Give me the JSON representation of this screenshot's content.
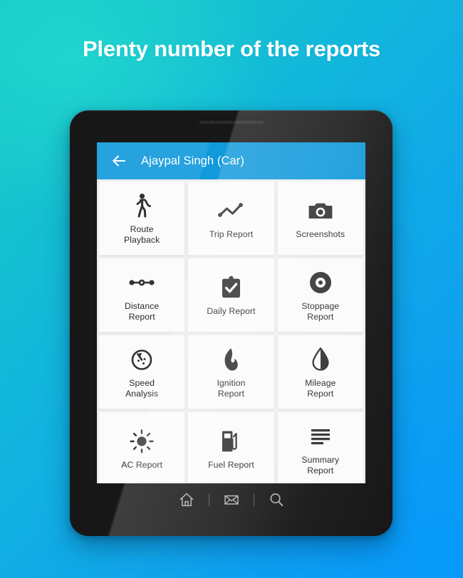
{
  "headline": "Plenty number of the reports",
  "app": {
    "appbar": {
      "back_icon": "arrow-left-icon",
      "title": "Ajaypal Singh (Car)",
      "background_color": "#1099db"
    },
    "reports": [
      {
        "label": "Route\nPlayback",
        "icon": "walking-person-icon"
      },
      {
        "label": "Trip Report",
        "icon": "line-chart-icon"
      },
      {
        "label": "Screenshots",
        "icon": "camera-icon"
      },
      {
        "label": "Distance\nReport",
        "icon": "dots-path-icon"
      },
      {
        "label": "Daily Report",
        "icon": "clipboard-check-icon"
      },
      {
        "label": "Stoppage\nReport",
        "icon": "disc-icon"
      },
      {
        "label": "Speed\nAnalysis",
        "icon": "speedometer-icon"
      },
      {
        "label": "Ignition\nReport",
        "icon": "flame-icon"
      },
      {
        "label": "Mileage\nReport",
        "icon": "half-filled-droplet-icon"
      },
      {
        "label": "AC Report",
        "icon": "sun-icon"
      },
      {
        "label": "Fuel Report",
        "icon": "fuel-pump-icon"
      },
      {
        "label": "Summary\nReport",
        "icon": "list-lines-icon"
      },
      {
        "label": "",
        "icon": "truck-icon"
      }
    ]
  },
  "navbar": {
    "home_icon": "home-icon",
    "mail_icon": "envelope-icon",
    "search_icon": "search-icon"
  },
  "colors": {
    "background_start": "#18c9c6",
    "background_end": "#0d9cf5",
    "appbar": "#1099db",
    "card": "#fbfbfb",
    "screen_gap": "#f0f0f0",
    "icon": "#333333",
    "headline_text": "#ffffff"
  }
}
